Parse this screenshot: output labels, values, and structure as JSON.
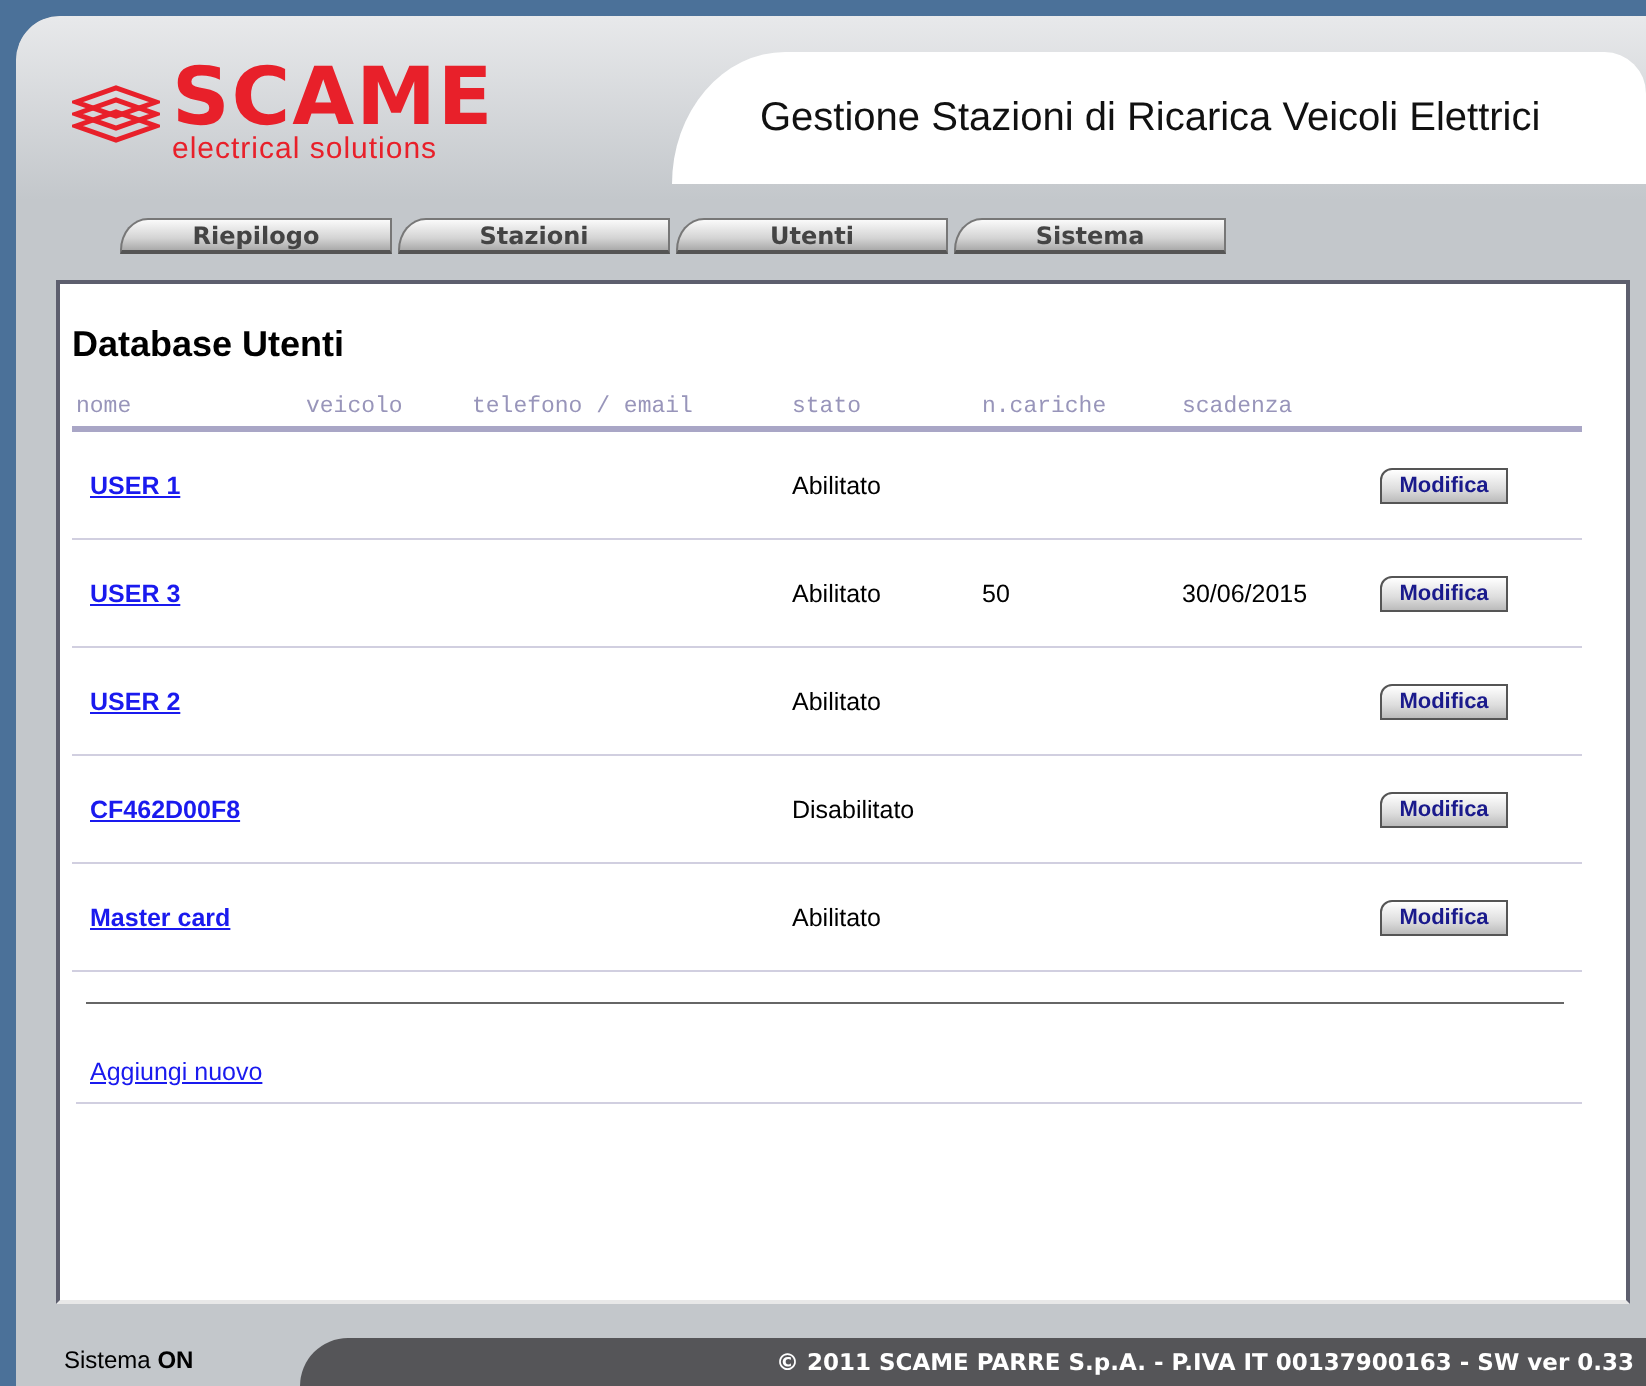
{
  "header": {
    "logo_name": "SCAME",
    "logo_tagline": "electrical solutions",
    "title": "Gestione Stazioni di Ricarica Veicoli Elettrici"
  },
  "tabs": [
    {
      "label": "Riepilogo",
      "selected": false
    },
    {
      "label": "Stazioni",
      "selected": false
    },
    {
      "label": "Utenti",
      "selected": false
    },
    {
      "label": "Sistema",
      "selected": false
    }
  ],
  "heading": "Database Utenti",
  "table": {
    "columns": [
      "nome",
      "veicolo",
      "telefono / email",
      "stato",
      "n.cariche",
      "scadenza"
    ],
    "rows": [
      {
        "nome": "USER 1",
        "stato": "Abilitato",
        "cariche": "",
        "scadenza": "",
        "action": "Modifica"
      },
      {
        "nome": "USER 3",
        "stato": "Abilitato",
        "cariche": "50",
        "scadenza": "30/06/2015",
        "action": "Modifica"
      },
      {
        "nome": "USER 2",
        "stato": "Abilitato",
        "cariche": "",
        "scadenza": "",
        "action": "Modifica"
      },
      {
        "nome": "CF462D00F8",
        "stato": "Disabilitato",
        "cariche": "",
        "scadenza": "",
        "action": "Modifica"
      },
      {
        "nome": "Master card",
        "stato": "Abilitato",
        "cariche": "",
        "scadenza": "",
        "action": "Modifica"
      }
    ]
  },
  "add_link": "Aggiungi nuovo",
  "status": {
    "label": "Sistema",
    "value": "ON"
  },
  "footer": "© 2011 SCAME PARRE S.p.A. - P.IVA IT 00137900163 - SW ver 0.33"
}
